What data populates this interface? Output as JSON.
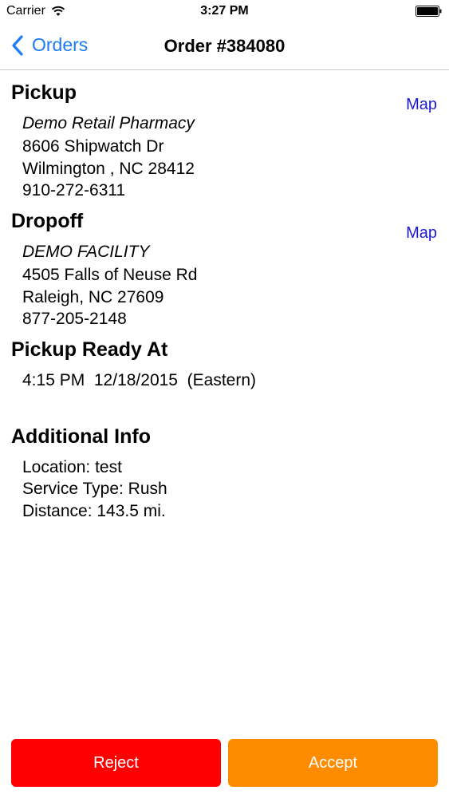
{
  "status_bar": {
    "carrier": "Carrier",
    "time": "3:27 PM"
  },
  "nav": {
    "back_label": "Orders",
    "title": "Order #384080"
  },
  "pickup": {
    "title": "Pickup",
    "map_label": "Map",
    "name": "Demo Retail Pharmacy",
    "street": "8606 Shipwatch Dr",
    "city": "Wilmington , NC 28412",
    "phone": "910-272-6311"
  },
  "dropoff": {
    "title": "Dropoff",
    "map_label": "Map",
    "name": "DEMO FACILITY",
    "street": "4505 Falls of Neuse Rd",
    "city": "Raleigh, NC 27609",
    "phone": "877-205-2148"
  },
  "ready": {
    "title": "Pickup Ready At",
    "value": "4:15 PM  12/18/2015  (Eastern)"
  },
  "additional": {
    "title": "Additional Info",
    "location": "Location: test",
    "service_type": "Service Type: Rush",
    "distance": "Distance: 143.5 mi."
  },
  "actions": {
    "reject_label": "Reject",
    "accept_label": "Accept"
  },
  "colors": {
    "accent": "#1a7cf6",
    "map_link": "#1a1ad4",
    "reject": "#ff0000",
    "accept": "#ff8c00"
  },
  "icons": {
    "wifi": "wifi-icon",
    "battery": "battery-icon",
    "back": "chevron-left-icon"
  }
}
